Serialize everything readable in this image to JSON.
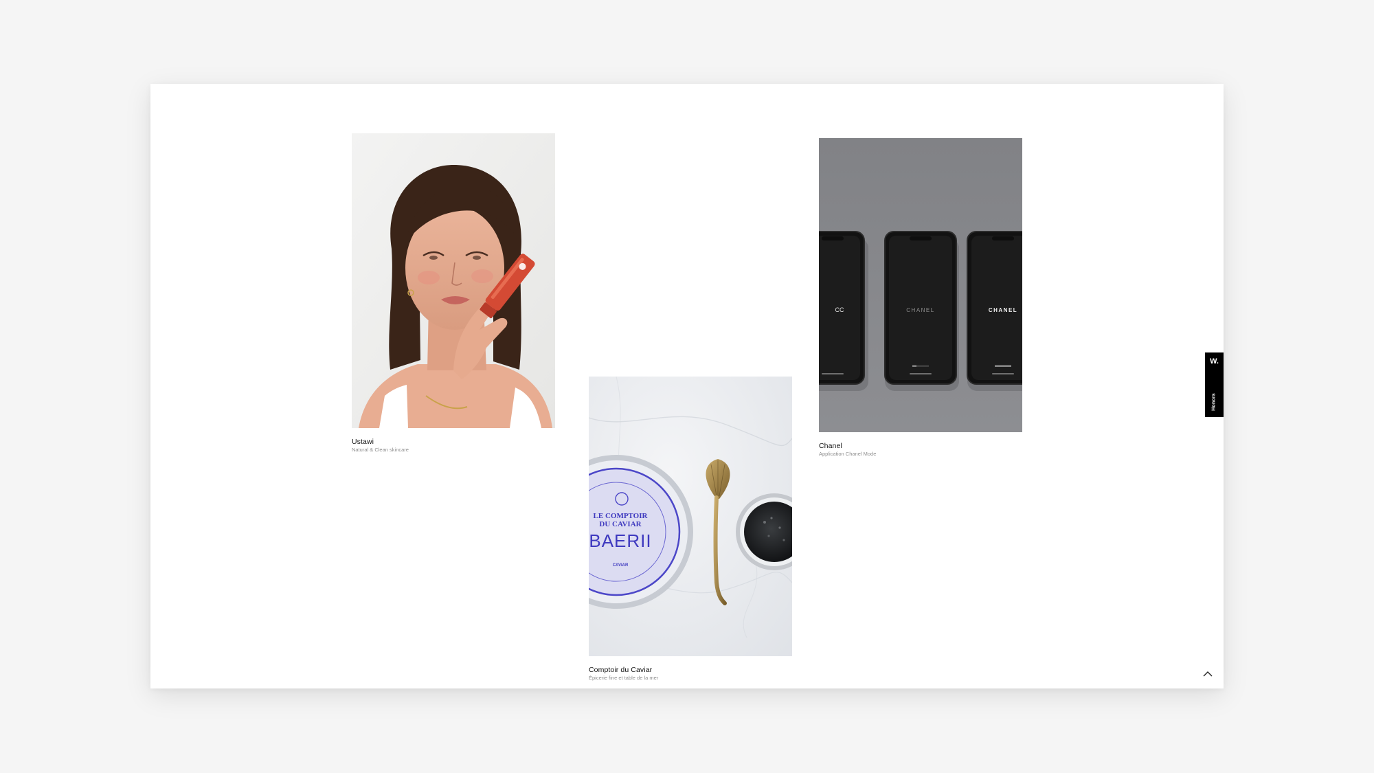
{
  "projects": [
    {
      "title": "Ustawi",
      "subtitle": "Natural & Clean skincare",
      "image": "woman-with-red-skincare-tube-photo"
    },
    {
      "title": "Comptoir du Caviar",
      "subtitle": "Épicerie fine et table de la mer",
      "image": "caviar-tin-and-shell-spoon-photo",
      "tin_text": {
        "brand_line1": "LE COMPTOIR",
        "brand_line2": "DU CAVIAR",
        "variety": "BAERII",
        "small_mark": "CAVIAR"
      }
    },
    {
      "title": "Chanel",
      "subtitle": "Application Chanel Mode",
      "image": "three-phones-chanel-app-mockup",
      "screens": [
        "CC",
        "CHANEL",
        "CHANEL"
      ]
    }
  ],
  "side_badge": {
    "logo": "W.",
    "label": "Honors"
  },
  "scroll_top": {
    "icon": "chevron-up-icon"
  },
  "colors": {
    "background": "#f5f5f5",
    "page": "#ffffff",
    "text": "#111111",
    "muted": "#8e8e8e",
    "badge": "#000000"
  }
}
